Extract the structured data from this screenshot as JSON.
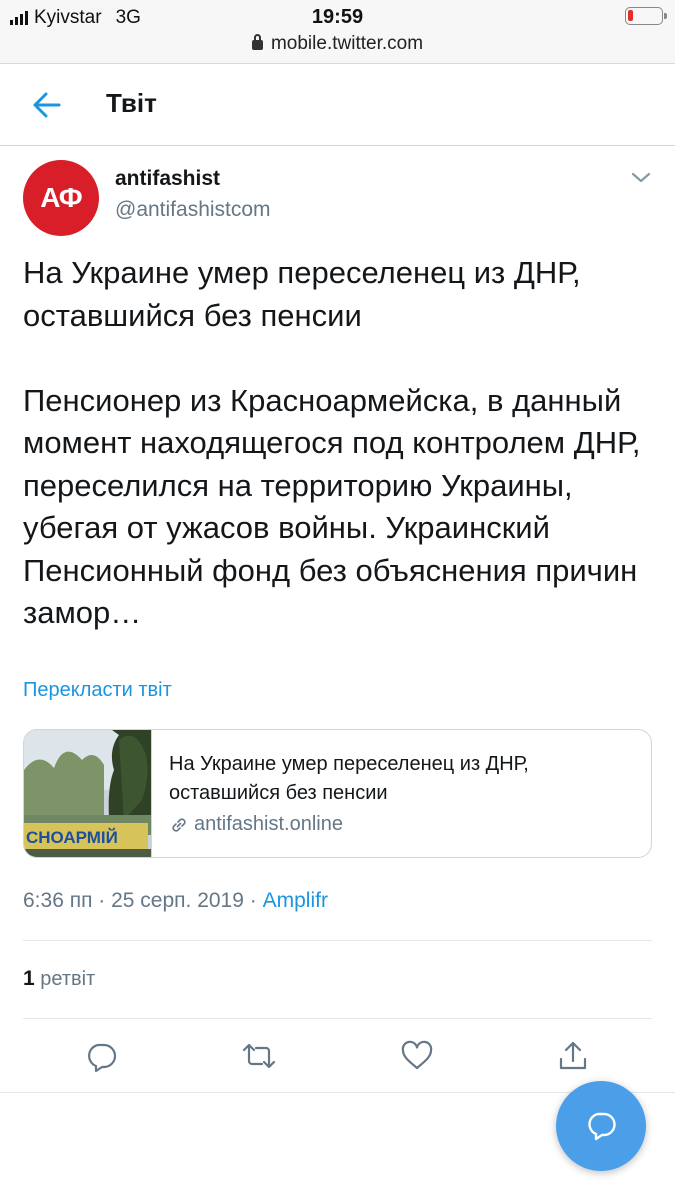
{
  "status_bar": {
    "carrier": "Kyivstar",
    "network": "3G",
    "time": "19:59",
    "url": "mobile.twitter.com",
    "battery_level_percent": 8
  },
  "header": {
    "title": "Твіт"
  },
  "author": {
    "avatar_text": "АФ",
    "name": "antifashist",
    "handle": "@antifashistcom"
  },
  "tweet": {
    "headline": "На Украине умер переселенец из ДНР, оставшийся без пенсии",
    "body": "Пенсионер из Красноармейска, в данный момент находящегося под контролем ДНР, переселился на территорию Украины, убегая от ужасов войны. Украинский Пенсионный фонд без объяснения причин замор…",
    "translate_label": "Перекласти твіт"
  },
  "card": {
    "title": "На Украине умер переселенец из ДНР, оставшийся без пенсии",
    "domain": "antifashist.online",
    "image_text": "СНОАРМІЙ"
  },
  "meta": {
    "timestamp": "6:36 пп · 25 серп. 2019 · ",
    "source": "Amplifr"
  },
  "stats": {
    "retweet_count": "1",
    "retweet_label": "ретвіт"
  },
  "actions": {
    "icons": [
      "reply-icon",
      "retweet-icon",
      "like-icon",
      "share-icon"
    ]
  },
  "fab": {
    "icon": "compose-message-icon"
  },
  "colors": {
    "accent": "#1b95e0",
    "avatar_red": "#d81e28",
    "fab_blue": "#4a9fe8",
    "muted_text": "#657786"
  }
}
